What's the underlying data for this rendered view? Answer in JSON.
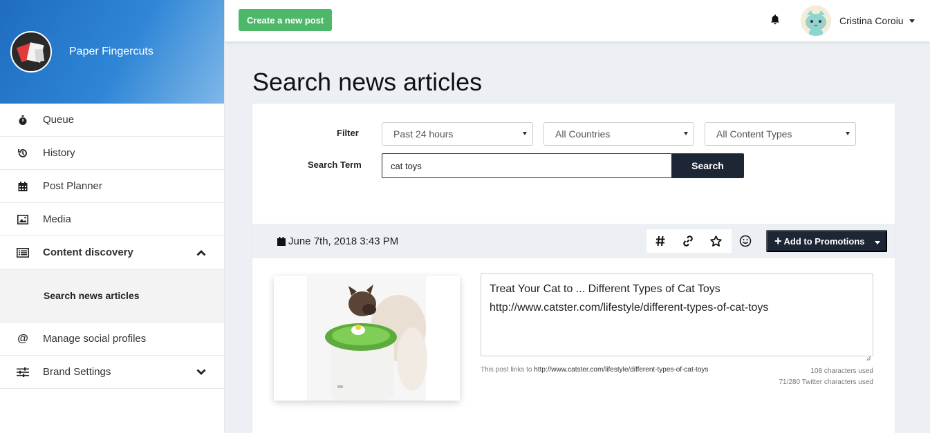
{
  "brand": {
    "name": "Paper Fingercuts"
  },
  "sidebar": {
    "items": [
      {
        "label": "Queue",
        "icon": "stopwatch-icon"
      },
      {
        "label": "History",
        "icon": "history-icon"
      },
      {
        "label": "Post Planner",
        "icon": "calendar-icon"
      },
      {
        "label": "Media",
        "icon": "image-icon"
      },
      {
        "label": "Content discovery",
        "icon": "list-icon",
        "expanded": true
      },
      {
        "label": "Manage social profiles",
        "icon": "at-icon"
      },
      {
        "label": "Brand Settings",
        "icon": "sliders-icon",
        "expanded": false
      }
    ],
    "sub_item": {
      "label": "Search news articles"
    }
  },
  "topbar": {
    "create_label": "Create a new post",
    "user_name": "Cristina Coroiu"
  },
  "main": {
    "title": "Search news articles",
    "filter_label": "Filter",
    "search_term_label": "Search Term",
    "filters": {
      "time": "Past 24 hours",
      "country": "All Countries",
      "content_type": "All Content Types"
    },
    "search": {
      "value": "cat toys",
      "button_label": "Search"
    }
  },
  "article": {
    "date": "June 7th, 2018 3:43 PM",
    "add_promotions_label": "Add to Promotions",
    "text_line1": "Treat Your Cat to ... Different Types of Cat Toys",
    "text_line2": "http://www.catster.com/lifestyle/different-types-of-cat-toys",
    "links_prefix": "This post links to",
    "links_url": "http://www.catster.com/lifestyle/different-types-of-cat-toys",
    "chars_used": "108 characters used",
    "twitter_chars": "71/280 Twitter characters used"
  },
  "colors": {
    "brand_gradient_start": "#1e6cc0",
    "create_button": "#4db76a",
    "dark_button": "#1d2634",
    "page_background": "#eceff4"
  }
}
